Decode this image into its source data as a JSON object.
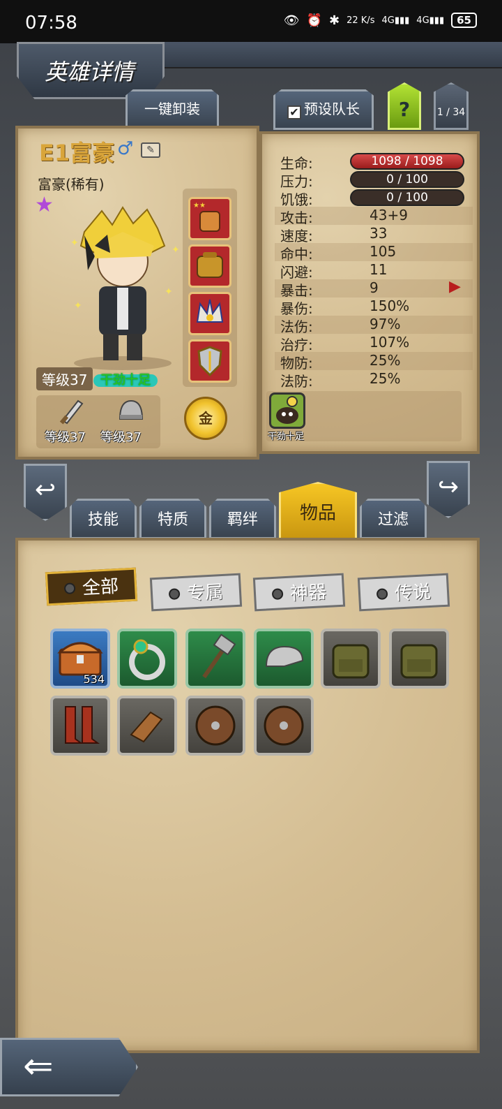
{
  "status_bar": {
    "time": "07:58",
    "net_speed": "22 K/s",
    "signal1": "4G",
    "signal2": "4G",
    "battery": "65"
  },
  "header": {
    "title": "英雄详情",
    "unequip_all": "一键卸装",
    "preset_captain": "预设队长",
    "help": "?",
    "page_indicator": "1 / 34"
  },
  "hero": {
    "name": "E1富豪",
    "class_rarity": "富豪(稀有)",
    "level": "等级37",
    "trait_tag": "干劲十足",
    "weapon_level": "等级37",
    "armor_level": "等级37",
    "coin_label": "金"
  },
  "stats": {
    "hp": {
      "label": "生命:",
      "value": "1098 / 1098"
    },
    "stress": {
      "label": "压力:",
      "value": "0 / 100"
    },
    "hunger": {
      "label": "饥饿:",
      "value": "0 / 100"
    },
    "rows": [
      {
        "label": "攻击:",
        "value": "43+9"
      },
      {
        "label": "速度:",
        "value": "33"
      },
      {
        "label": "命中:",
        "value": "105"
      },
      {
        "label": "闪避:",
        "value": "11"
      },
      {
        "label": "暴击:",
        "value": "9"
      },
      {
        "label": "暴伤:",
        "value": "150%"
      },
      {
        "label": "法伤:",
        "value": "97%"
      },
      {
        "label": "治疗:",
        "value": "107%"
      },
      {
        "label": "物防:",
        "value": "25%"
      },
      {
        "label": "法防:",
        "value": "25%"
      }
    ],
    "trait_caption": "干劲十足"
  },
  "tabs": {
    "skills": "技能",
    "traits": "特质",
    "bonds": "羁绊",
    "items": "物品",
    "filter": "过滤"
  },
  "filters": {
    "all": "全部",
    "exclusive": "专属",
    "artifact": "神器",
    "legendary": "传说"
  },
  "items": {
    "chest_count": "534"
  },
  "colors": {
    "accent_gold": "#f6c624",
    "hp_red": "#d84a4a",
    "rare_purple": "#b04ad8"
  }
}
